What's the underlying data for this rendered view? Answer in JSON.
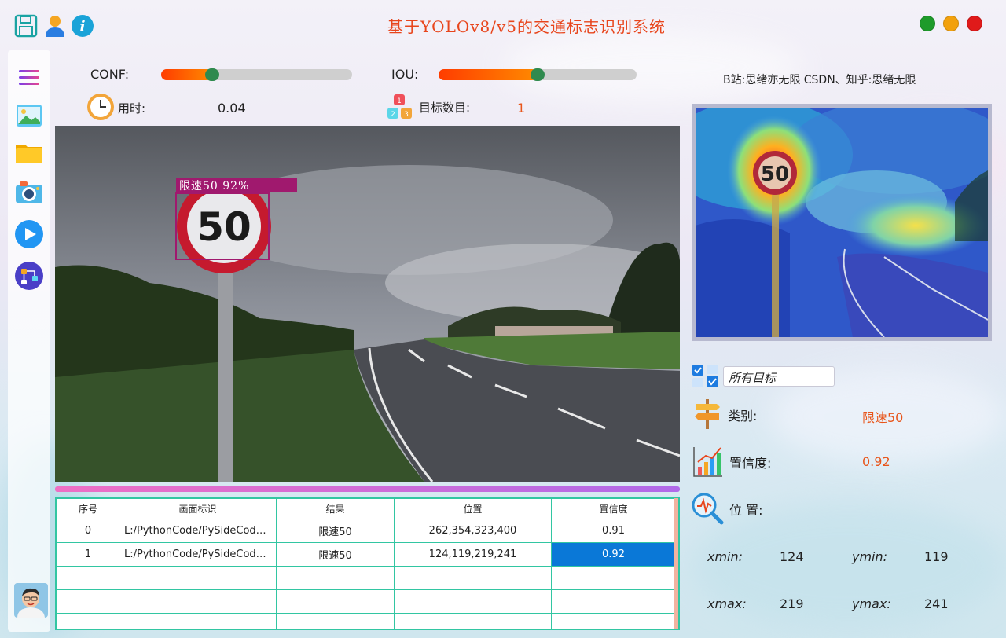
{
  "window": {
    "title": "基于YOLOv8/v5的交通标志识别系统",
    "buttons": {
      "green": "#1e9b2a",
      "yellow": "#f2a10d",
      "red": "#e01a1a"
    }
  },
  "toolbar": {
    "icons": [
      "save-icon",
      "user-icon",
      "info-icon"
    ]
  },
  "sidebar": {
    "icons": [
      "menu-icon",
      "image-icon",
      "folder-icon",
      "camera-icon",
      "play-icon",
      "model-icon",
      "avatar"
    ]
  },
  "params": {
    "conf_label": "CONF:",
    "conf_value": 0.25,
    "iou_label": "IOU:",
    "iou_value": 0.5,
    "credit": "B站:思绪亦无限 CSDN、知乎:思绪无限",
    "time_label": "用时:",
    "time_value": "0.04",
    "count_label": "目标数目:",
    "count_value": "1"
  },
  "detection": {
    "label": "限速50 92%",
    "sign_text": "50",
    "heat_sign_text": "50"
  },
  "table": {
    "headers": [
      "序号",
      "画面标识",
      "结果",
      "位置",
      "置信度"
    ],
    "rows": [
      [
        "0",
        "L:/PythonCode/PySideCode/...",
        "限速50",
        "262,354,323,400",
        "0.91"
      ],
      [
        "1",
        "L:/PythonCode/PySideCode/...",
        "限速50",
        "124,119,219,241",
        "0.92"
      ]
    ],
    "empty_rows": 3
  },
  "panel": {
    "target_select": "所有目标",
    "class_label": "类别:",
    "class_value": "限速50",
    "conf_label": "置信度:",
    "conf_value": "0.92",
    "pos_label": "位 置:",
    "xmin_label": "xmin:",
    "xmin": "124",
    "ymin_label": "ymin:",
    "ymin": "119",
    "xmax_label": "xmax:",
    "xmax": "219",
    "ymax_label": "ymax:",
    "ymax": "241"
  },
  "colors": {
    "accent": "#e8551a",
    "table_border": "#32c6a2",
    "selection": "#0a78d7"
  }
}
